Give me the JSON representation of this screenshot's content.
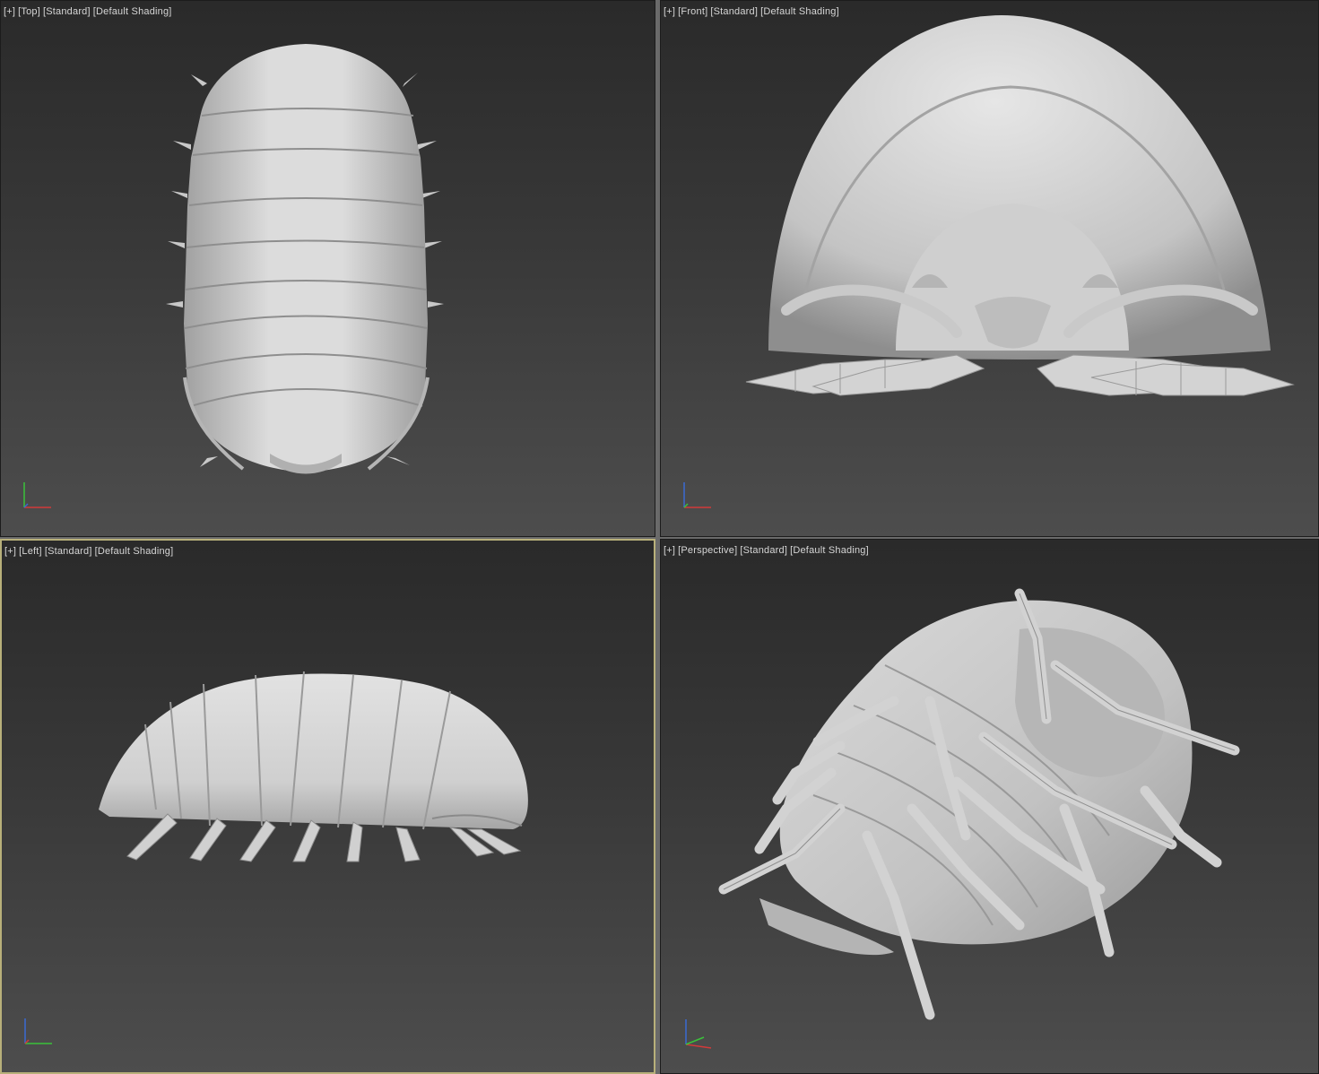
{
  "viewports": {
    "top": {
      "menu": "[+]",
      "view": "[Top]",
      "style": "[Standard]",
      "shading": "[Default Shading]"
    },
    "front": {
      "menu": "[+]",
      "view": "[Front]",
      "style": "[Standard]",
      "shading": "[Default Shading]"
    },
    "left": {
      "menu": "[+]",
      "view": "[Left]",
      "style": "[Standard]",
      "shading": "[Default Shading]"
    },
    "persp": {
      "menu": "[+]",
      "view": "[Perspective]",
      "style": "[Standard]",
      "shading": "[Default Shading]"
    }
  },
  "active_viewport": "left",
  "colors": {
    "model": "#d8d8d8",
    "model_shade": "#a9a9a9",
    "model_dark": "#8c8c8c",
    "active_border": "#b8b07a",
    "axis_x": "#d23a3a",
    "axis_y": "#3ac23a",
    "axis_z": "#3a6ad2"
  }
}
